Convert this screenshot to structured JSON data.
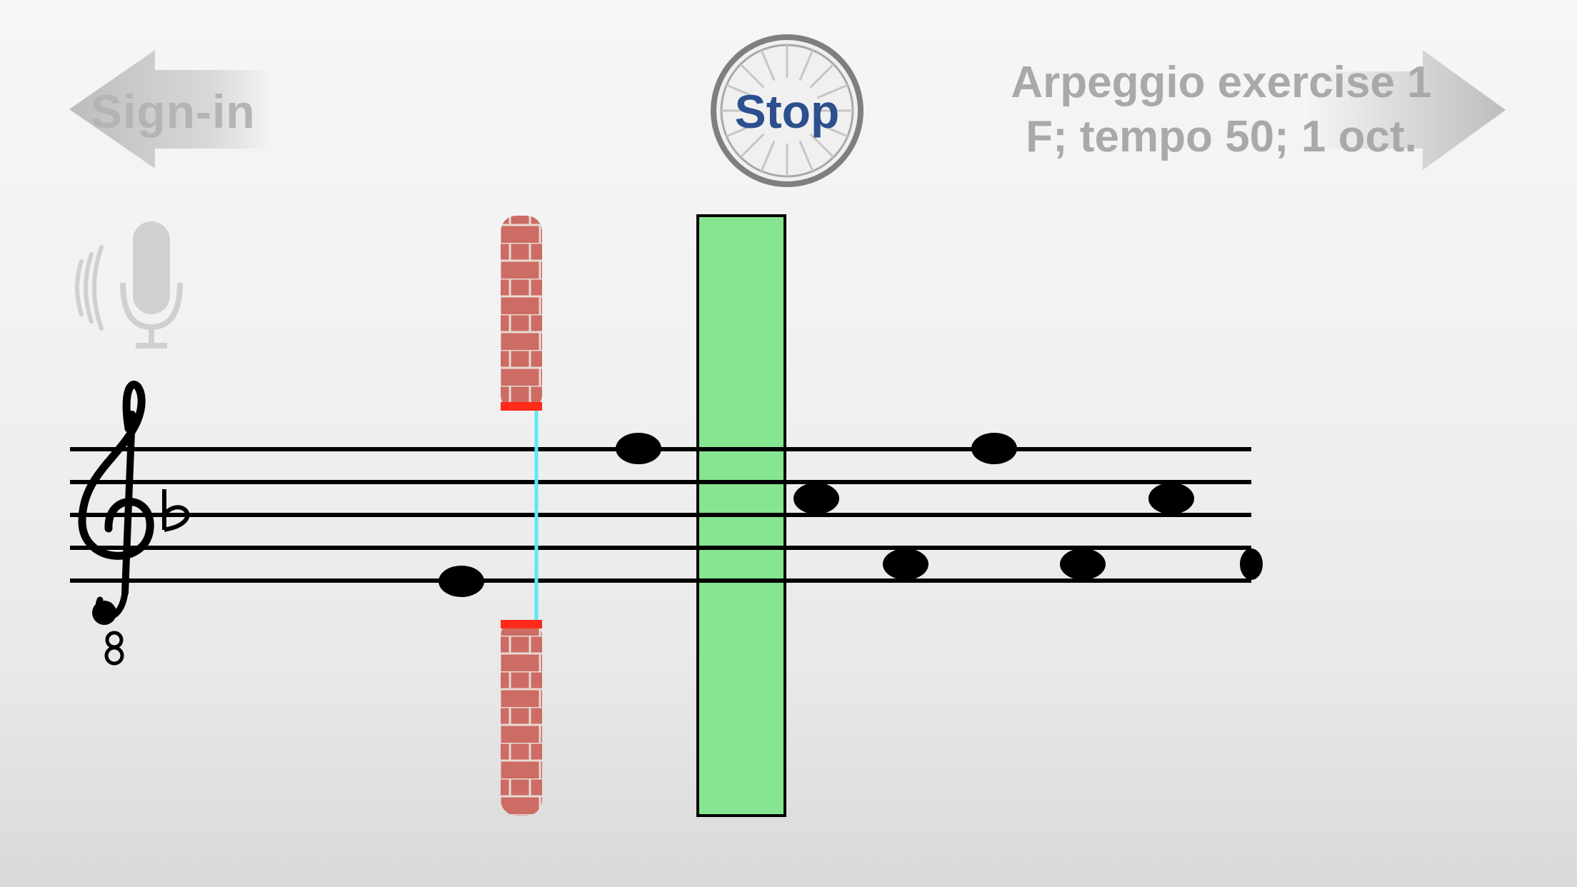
{
  "header": {
    "signin_label": "Sign-in",
    "stop_label": "Stop",
    "exercise_line1": "Arpeggio exercise 1",
    "exercise_line2": "F; tempo 50; 1 oct."
  },
  "colors": {
    "stop_text": "#2c4f8e",
    "hit_zone": "#86e590",
    "brick": "#c9625a",
    "cursor_line": "#5ee8f5",
    "gate_edge": "#ff2a1a"
  },
  "icons": {
    "back": "left-arrow-icon",
    "next": "right-arrow-icon",
    "mic": "microphone-icon",
    "stop": "wheel-icon"
  },
  "score": {
    "clef": "treble-8vb",
    "key_signature": "F major (1 flat)"
  }
}
